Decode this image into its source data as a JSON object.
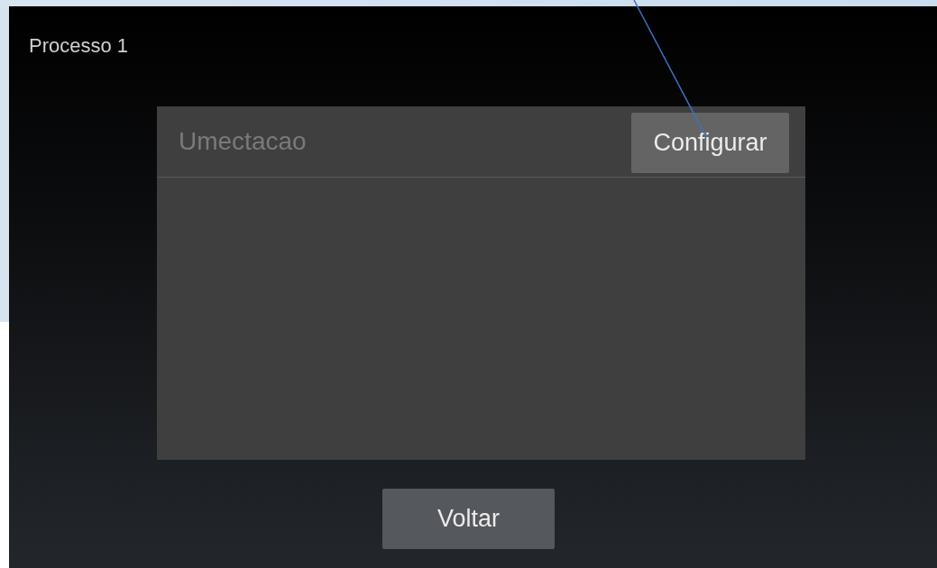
{
  "screen": {
    "title": "Processo 1"
  },
  "panel": {
    "title": "Umectacao",
    "button": "Configurar"
  },
  "buttons": [
    "Voltar"
  ]
}
